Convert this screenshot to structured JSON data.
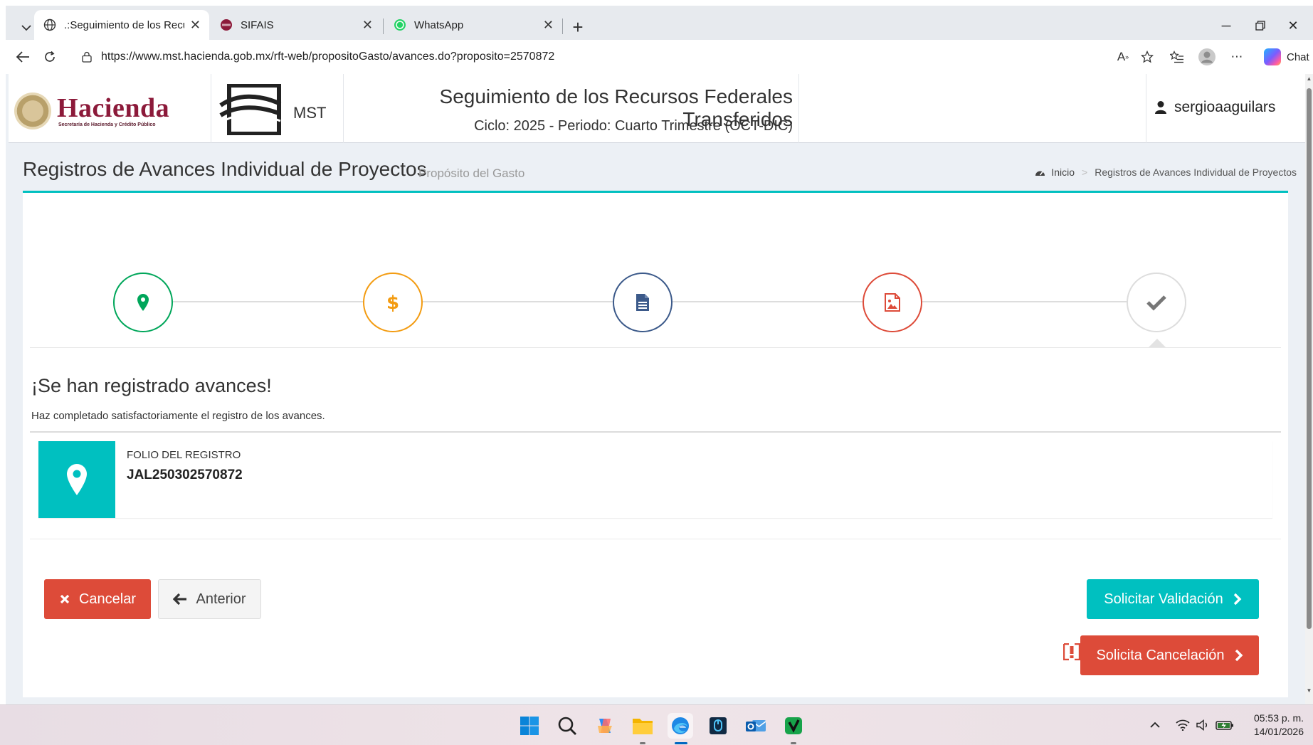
{
  "browser": {
    "tabs": [
      {
        "title": ".:Seguimiento de los Recursos Federales Transferidos",
        "icon": "globe-icon",
        "active": true
      },
      {
        "title": "SIFAIS",
        "icon": "sifais-favicon",
        "active": false
      },
      {
        "title": "WhatsApp",
        "icon": "whatsapp-icon",
        "active": false
      }
    ],
    "url": "https://www.mst.hacienda.gob.mx/rft-web/propositoGasto/avances.do?proposito=2570872",
    "chat_label": "Chat"
  },
  "header": {
    "brand": "Hacienda",
    "brand_sub": "Secretaría de Hacienda y Crédito Público",
    "mst_label": "MST",
    "title": "Seguimiento de los Recursos Federales Transferidos",
    "cycle": "Ciclo: 2025 - Periodo: Cuarto Trimestre (OCT-DIC)",
    "user": "sergioaaguilars"
  },
  "content": {
    "title": "Registros de Avances Individual de Proyectos",
    "subtitle": "Propósito del Gasto",
    "breadcrumb": {
      "home": "Inicio",
      "current": "Registros de Avances Individual de Proyectos"
    }
  },
  "steps": [
    {
      "icon": "map-marker-icon",
      "color": "#00a65a"
    },
    {
      "icon": "dollar-icon",
      "color": "#f39c12"
    },
    {
      "icon": "document-icon",
      "color": "#3c5a8a"
    },
    {
      "icon": "image-icon",
      "color": "#dd4b39"
    },
    {
      "icon": "check-icon",
      "color": "#777777"
    }
  ],
  "result": {
    "title": "¡Se han registrado avances!",
    "description": "Haz completado satisfactoriamente el registro de los avances.",
    "folio_label": "Folio del Registro",
    "folio_value": "JAL250302570872"
  },
  "buttons": {
    "cancel": "Cancelar",
    "previous": "Anterior",
    "request_validation": "Solicitar Validación",
    "request_cancellation": "Solicita Cancelación"
  },
  "colors": {
    "accent": "#00c0c0",
    "danger": "#dd4b39",
    "brand": "#8c1a3a"
  },
  "taskbar": {
    "time": "05:53 p. m.",
    "date": "14/01/2026"
  }
}
